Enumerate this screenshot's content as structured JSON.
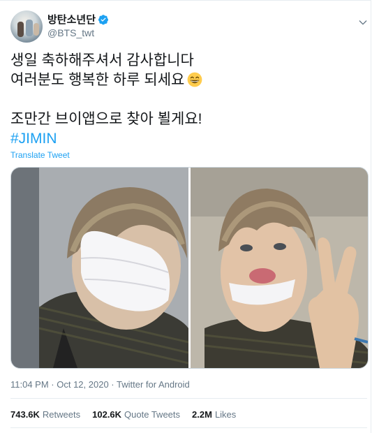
{
  "author": {
    "display_name": "방탄소년단",
    "handle": "@BTS_twt",
    "verified": true
  },
  "tweet": {
    "lines": [
      "생일 축하해주셔서 감사합니다",
      "여러분도 행복한 하루 되세요",
      "조만간 브이앱으로 찾아 뵐게요!"
    ],
    "emoji": "grinning-face-with-smiling-eyes",
    "hashtag": "#JIMIN",
    "translate_label": "Translate Tweet"
  },
  "media": {
    "photo_count": 2
  },
  "meta": {
    "timestamp": "11:04 PM · Oct 12, 2020 · Twitter for Android"
  },
  "stats": {
    "retweets_count": "743.6K",
    "retweets_label": "Retweets",
    "quote_count": "102.6K",
    "quote_label": "Quote Tweets",
    "likes_count": "2.2M",
    "likes_label": "Likes"
  },
  "colors": {
    "link": "#1da1f2",
    "secondary_text": "#657786",
    "primary_text": "#14171a",
    "border": "#e6ecf0"
  }
}
